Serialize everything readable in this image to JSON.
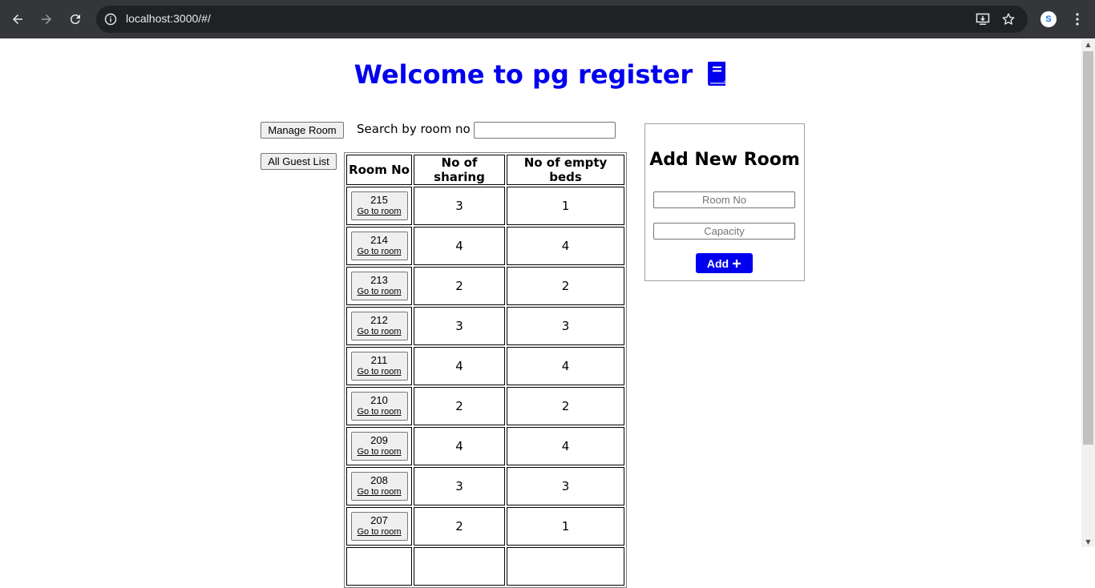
{
  "browser": {
    "url": "localhost:3000/#/"
  },
  "page": {
    "title": "Welcome to pg register",
    "manage_room_label": "Manage Room",
    "all_guest_list_label": "All Guest List",
    "search_label": "Search by room no :",
    "search_value": ""
  },
  "table": {
    "headers": [
      "Room No",
      "No of sharing",
      "No of empty beds"
    ],
    "go_to_room_label": "Go to room",
    "rows": [
      {
        "room": "215",
        "sharing": "3",
        "empty": "1"
      },
      {
        "room": "214",
        "sharing": "4",
        "empty": "4"
      },
      {
        "room": "213",
        "sharing": "2",
        "empty": "2"
      },
      {
        "room": "212",
        "sharing": "3",
        "empty": "3"
      },
      {
        "room": "211",
        "sharing": "4",
        "empty": "4"
      },
      {
        "room": "210",
        "sharing": "2",
        "empty": "2"
      },
      {
        "room": "209",
        "sharing": "4",
        "empty": "4"
      },
      {
        "room": "208",
        "sharing": "3",
        "empty": "3"
      },
      {
        "room": "207",
        "sharing": "2",
        "empty": "1"
      },
      {
        "room": "",
        "sharing": "",
        "empty": ""
      }
    ]
  },
  "add_room": {
    "title": "Add New Room",
    "room_no_placeholder": "Room No",
    "capacity_placeholder": "Capacity",
    "add_label": "Add"
  },
  "colors": {
    "accent": "#0000ee",
    "chrome_bg": "#35363a",
    "omnibox_bg": "#202124"
  },
  "icons": [
    "back-arrow-icon",
    "forward-arrow-icon",
    "reload-icon",
    "site-info-icon",
    "install-app-icon",
    "bookmark-star-icon",
    "profile-avatar-icon",
    "more-menu-icon",
    "book-icon",
    "plus-icon"
  ]
}
